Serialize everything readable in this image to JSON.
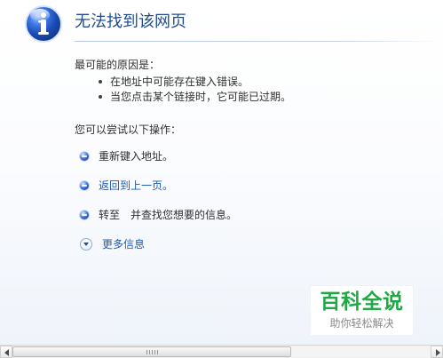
{
  "header": {
    "icon": "info-icon",
    "title": "无法找到该网页"
  },
  "reasons": {
    "heading": "最可能的原因是：",
    "items": [
      "在地址中可能存在键入错误。",
      "当您点击某个链接时，它可能已过期。"
    ]
  },
  "actions": {
    "heading": "您可以尝试以下操作：",
    "items": [
      {
        "label": "重新键入地址。",
        "icon": "bullet-icon"
      },
      {
        "label": "返回到上一页。",
        "icon": "bullet-icon"
      },
      {
        "label": "转至　并查找您想要的信息。",
        "icon": "bullet-icon"
      },
      {
        "label": "更多信息",
        "icon": "chevron-down-icon"
      }
    ]
  },
  "watermark": {
    "title": "百科全说",
    "subtitle": "助你轻松解决",
    "accent_color": "#20a844"
  },
  "colors": {
    "title_color": "#214c8f",
    "link_color": "#1d5bb6"
  }
}
